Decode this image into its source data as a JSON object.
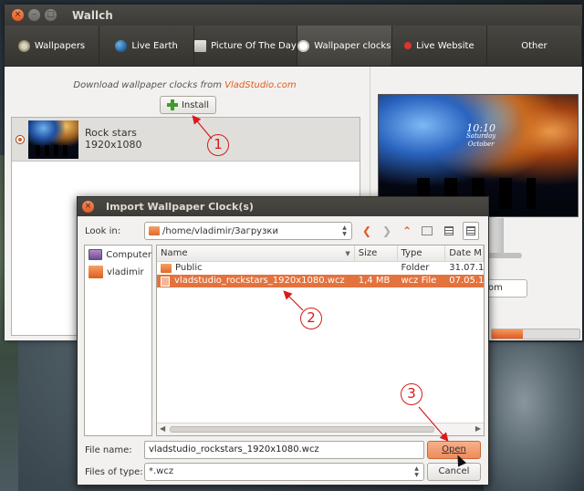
{
  "window": {
    "title": "Wallch",
    "controls": {
      "close": "×",
      "minimize": "–",
      "maximize": "□"
    }
  },
  "tabs": [
    {
      "label": "Wallpapers",
      "icon": "wallpapers-icon",
      "active": false
    },
    {
      "label": "Live Earth",
      "icon": "globe-icon",
      "active": false
    },
    {
      "label": "Picture Of The Day",
      "icon": "picture-icon",
      "active": false
    },
    {
      "label": "Wallpaper clocks",
      "icon": "clock-icon",
      "active": true
    },
    {
      "label": "Live Website",
      "icon": "pin-icon",
      "active": false
    },
    {
      "label": "Other",
      "icon": "",
      "active": false
    }
  ],
  "clocks_panel": {
    "download_prefix": "Download wallpaper clocks from ",
    "download_link": "VladStudio.com",
    "install_label": "Install",
    "items": [
      {
        "name": "Rock stars",
        "resolution": "1920x1080",
        "selected": true
      }
    ]
  },
  "preview": {
    "clock_text_1": "10:10",
    "clock_text_2": "Saturday",
    "clock_text_3": "October",
    "combo_partial": "om",
    "progress": 0.35
  },
  "dialog": {
    "title": "Import Wallpaper Clock(s)",
    "look_in_label": "Look in:",
    "path": "/home/vladimir/Загрузки",
    "places": [
      {
        "label": "Computer",
        "icon": "computer-icon"
      },
      {
        "label": "vladimir",
        "icon": "home-folder-icon"
      }
    ],
    "columns": [
      "Name",
      "Size",
      "Type",
      "Date M"
    ],
    "files": [
      {
        "name": "Public",
        "size": "",
        "type": "Folder",
        "date": "31.07.1",
        "kind": "folder",
        "selected": false
      },
      {
        "name": "vladstudio_rockstars_1920x1080.wcz",
        "size": "1,4 MB",
        "type": "wcz File",
        "date": "07.05.1",
        "kind": "file",
        "selected": true
      }
    ],
    "file_name_label": "File name:",
    "file_name_value": "vladstudio_rockstars_1920x1080.wcz",
    "files_of_type_label": "Files of type:",
    "files_of_type_value": "*.wcz",
    "open_label": "Open",
    "cancel_label": "Cancel"
  },
  "annotations": {
    "step1": "1",
    "step2": "2",
    "step3": "3",
    "color": "#d61a1a"
  },
  "colors": {
    "accent": "#e05a23",
    "selection": "#e4723d",
    "title_bar": "#3c3b37"
  }
}
